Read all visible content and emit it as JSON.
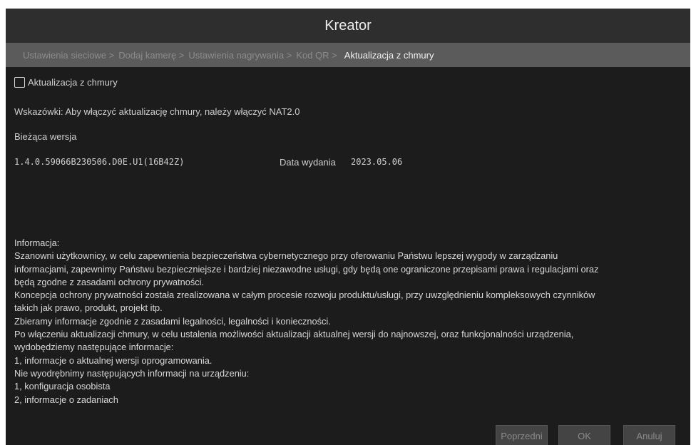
{
  "window": {
    "title": "Kreator"
  },
  "steps": [
    {
      "label": "Ustawienia sieciowe >"
    },
    {
      "label": "Dodaj kamerę >"
    },
    {
      "label": "Ustawienia nagrywania >"
    },
    {
      "label": "Kod QR >"
    },
    {
      "label": "Aktualizacja z chmury"
    }
  ],
  "cloud_update": {
    "checkbox_label": "Aktualizacja z chmury",
    "checked": false
  },
  "tips": {
    "text": "Wskazówki: Aby włączyć aktualizację chmury, należy włączyć NAT2.0"
  },
  "version": {
    "heading": "Bieżąca wersja",
    "value": "1.4.0.59066B230506.D0E.U1(16B42Z)",
    "release_label": "Data wydania",
    "release_date": "2023.05.06"
  },
  "info_lines": [
    "Informacja:",
    "Szanowni użytkownicy, w celu zapewnienia bezpieczeństwa cybernetycznego przy oferowaniu Państwu lepszej wygody w zarządzaniu",
    "informacjami, zapewnimy Państwu bezpieczniejsze i bardziej niezawodne usługi, gdy będą one ograniczone przepisami prawa i regulacjami oraz",
    "będą zgodne z zasadami ochrony prywatności.",
    " Koncepcja ochrony prywatności została zrealizowana w całym procesie rozwoju produktu/usługi, przy uwzględnieniu kompleksowych czynników",
    "takich jak prawo, produkt, projekt itp.",
    " Zbieramy informacje zgodnie z zasadami legalności, legalności i konieczności.",
    " Po włączeniu aktualizacji chmury, w celu ustalenia możliwości aktualizacji aktualnej wersji do najnowszej, oraz funkcjonalności urządzenia,",
    " wydobędziemy następujące informacje:",
    " 1, informacje o aktualnej wersji oprogramowania.",
    " Nie wyodrębnimy następujących informacji na urządzeniu:",
    " 1, konfiguracja osobista",
    " 2, informacje o zadaniach"
  ],
  "buttons": {
    "prev": "Poprzedni",
    "ok": "OK",
    "cancel": "Anuluj"
  }
}
